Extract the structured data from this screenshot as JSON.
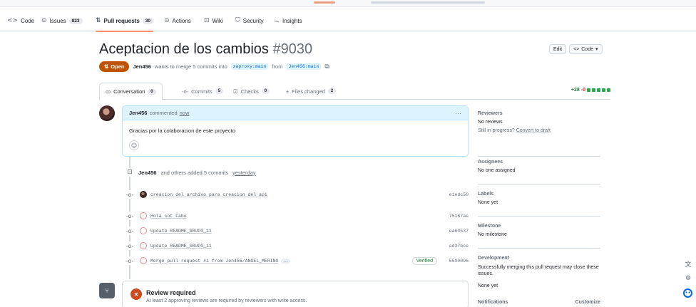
{
  "repo_nav": {
    "code": "Code",
    "issues": "Issues",
    "issues_count": "823",
    "pull_requests": "Pull requests",
    "pull_requests_count": "30",
    "actions": "Actions",
    "wiki": "Wiki",
    "security": "Security",
    "insights": "Insights"
  },
  "pr": {
    "title": "Aceptacion de los cambios",
    "number": "#9030",
    "state": "Open",
    "author": "Jen456",
    "merge_text": "wants to merge 5 commits into",
    "base_branch": "zaproxy:main",
    "from_text": "from",
    "head_branch": "Jen456:main"
  },
  "header_actions": {
    "edit": "Edit",
    "code": "Code"
  },
  "tabs": [
    {
      "label": "Conversation",
      "count": "0"
    },
    {
      "label": "Commits",
      "count": "5"
    },
    {
      "label": "Checks",
      "count": "0"
    },
    {
      "label": "Files changed",
      "count": "2"
    }
  ],
  "diffstat": {
    "additions": "+28",
    "deletions": "-0"
  },
  "comment": {
    "author": "Jen456",
    "action": "commented",
    "time": "now",
    "body": "Gracias por la colaboracion de este proyecto"
  },
  "commit_event": {
    "author": "Jen456",
    "text": "and others added 5 commits",
    "time": "yesterday"
  },
  "commits": [
    {
      "message": "creacion del archivo para creacion del api",
      "sha": "e1edc50"
    },
    {
      "message": "Hola sot Fabo",
      "sha": "75167ae"
    },
    {
      "message": "Update README_GRUPO_11",
      "sha": "ea60537"
    },
    {
      "message": "Update README_GRUPO_11",
      "sha": "ad37bce"
    },
    {
      "message": "Merge pull request #1 from Jen456/ANGEL_MERINO",
      "sha": "5500096",
      "more": "…",
      "badge": "Verified"
    }
  ],
  "review": {
    "title": "Review required",
    "subtitle": "At least 2 approving reviews are required by reviewers with write access."
  },
  "sidebar": {
    "reviewers_title": "Reviewers",
    "reviewers_value": "No reviews",
    "in_progress": "Still in progress?",
    "convert_draft": "Convert to draft",
    "assignees_title": "Assignees",
    "assignees_value": "No one assigned",
    "labels_title": "Labels",
    "labels_value": "None yet",
    "milestone_title": "Milestone",
    "milestone_value": "No milestone",
    "development_title": "Development",
    "development_value": "Successfully merging this pull request may close these issues.",
    "development_none": "None yet",
    "notifications_title": "Notifications",
    "notifications_action": "Customize"
  },
  "colors": {
    "open_badge": "#bf5305",
    "accent_link": "#0969da",
    "diff_add": "#1a7f37",
    "diff_del": "#cf222e",
    "active_tab_underline": "#fd8c73"
  }
}
